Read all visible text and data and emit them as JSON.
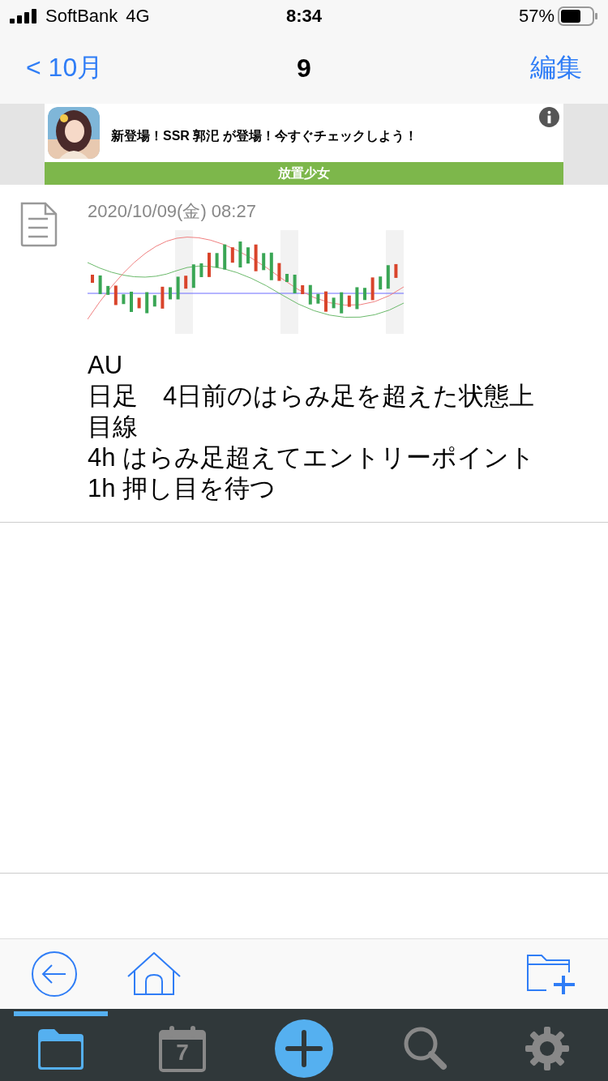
{
  "status_bar": {
    "carrier": "SoftBank",
    "network": "4G",
    "time": "8:34",
    "battery": "57%"
  },
  "nav": {
    "back": "< 10月",
    "title": "9",
    "edit": "編集"
  },
  "ad": {
    "text": "新登場！SSR 郭汜 が登場！今すぐチェックしよう！",
    "footer": "放置少女"
  },
  "entry": {
    "datetime": "2020/10/09(金) 08:27",
    "note": "AU\n日足　4日前のはらみ足を超えた状態上目線\n4h はらみ足超えてエントリーポイント 1h 押し目を待つ"
  },
  "tabs": [
    {
      "kind": "folder",
      "selected": true
    },
    {
      "kind": "calendar",
      "label": "7",
      "selected": false
    },
    {
      "kind": "add",
      "selected": false
    },
    {
      "kind": "search",
      "selected": false
    },
    {
      "kind": "settings",
      "selected": false
    }
  ]
}
